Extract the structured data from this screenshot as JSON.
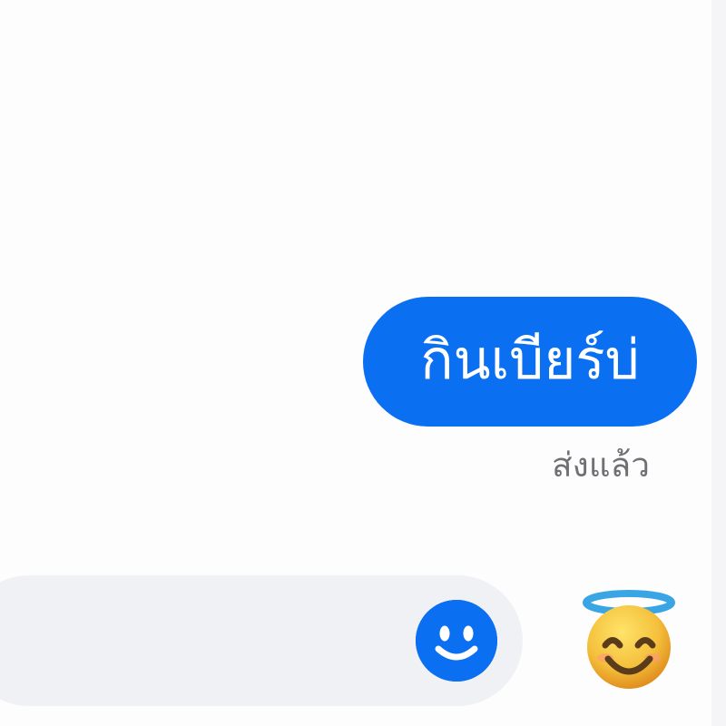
{
  "conversation": {
    "messages": [
      {
        "text": "กินเบียร์บ่",
        "status": "ส่งแล้ว"
      }
    ]
  },
  "composer": {
    "input_value": "",
    "placeholder": "",
    "emoji_picker_icon": "smiley-face-icon"
  },
  "quick_reaction": {
    "icon": "smiling-face-with-halo-icon"
  },
  "colors": {
    "accent": "#0b6ff2",
    "background": "#fdfdfe",
    "composer_background": "#f0f1f4",
    "status_text": "#6f7073",
    "emoji_face": "#f3bd35",
    "emoji_halo": "#3aa5e4"
  }
}
